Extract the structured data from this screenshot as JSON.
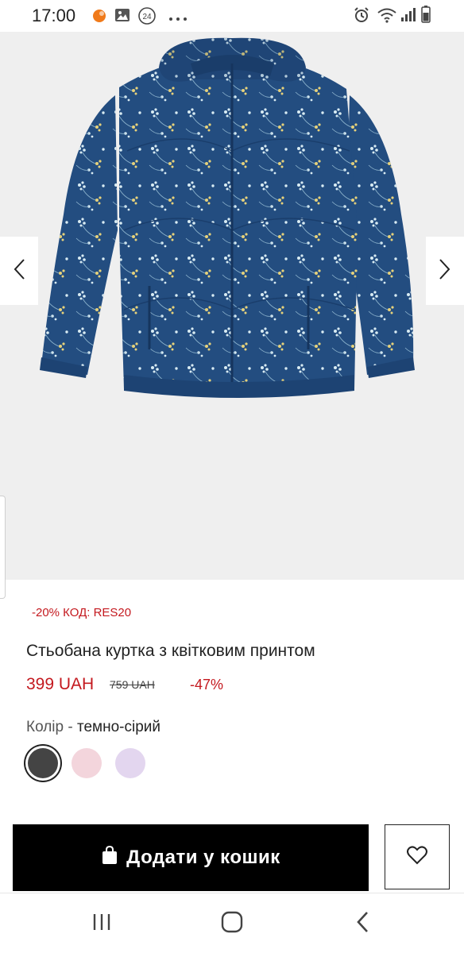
{
  "status_bar": {
    "time": "17:00",
    "notification_badge": "24"
  },
  "product": {
    "promo": "-20% КОД: RES20",
    "title": "Стьобана куртка з квітковим принтом",
    "price_current": "399 UAH",
    "price_old": "759 UAH",
    "discount": "-47%",
    "color_label": "Колір",
    "color_separator": " - ",
    "color_value": "темно-сірий",
    "swatches": [
      {
        "name": "темно-сірий",
        "hex": "#444444",
        "selected": true
      },
      {
        "name": "pink",
        "hex": "#f3d5dc",
        "selected": false
      },
      {
        "name": "lavender",
        "hex": "#e3d6ef",
        "selected": false
      }
    ],
    "jacket_color": "#234d80"
  },
  "actions": {
    "add_to_cart_label": "Додати у кошик"
  },
  "icons": {
    "prev": "chevron-left-icon",
    "next": "chevron-right-icon",
    "bag": "shopping-bag-icon",
    "wishlist": "heart-icon",
    "recents": "recent-apps-icon",
    "home": "home-icon",
    "back": "back-icon"
  }
}
